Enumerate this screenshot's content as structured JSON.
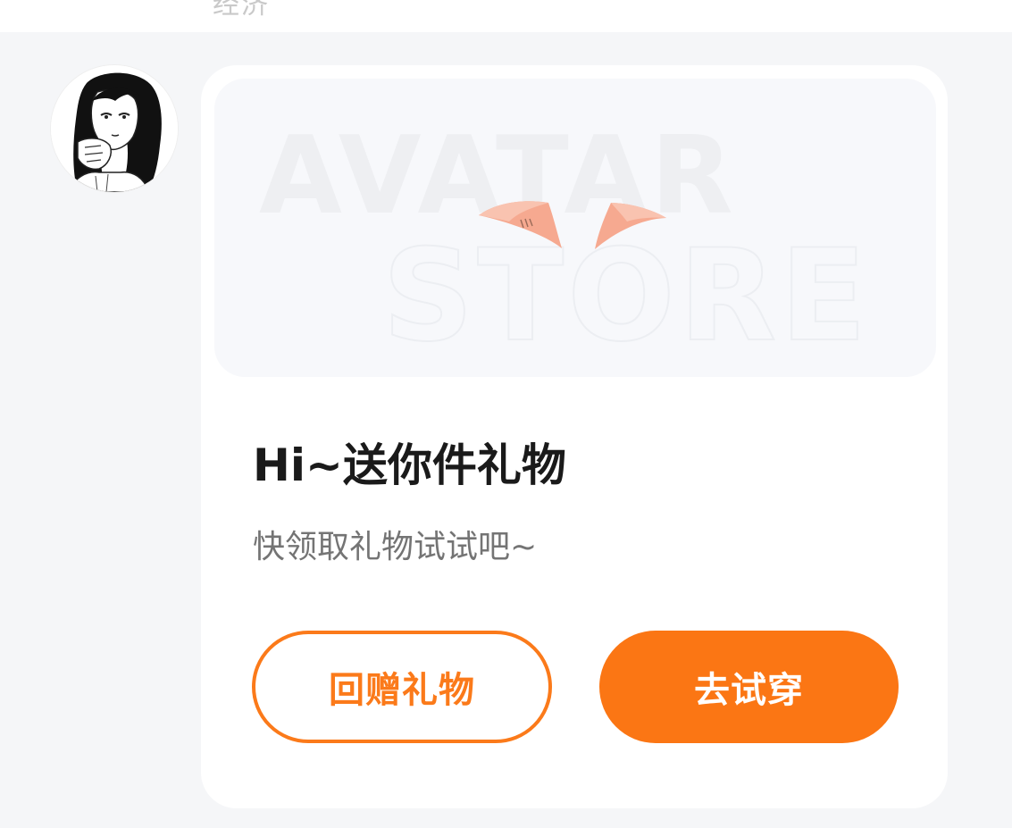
{
  "top_bar": {
    "partial_text": "经济"
  },
  "gift_card": {
    "banner": {
      "watermark_line1": "AVATAR",
      "watermark_line2": "STORE",
      "item_icon": "cat-ears-icon"
    },
    "title": "Hi~送你件礼物",
    "subtitle": "快领取礼物试试吧~",
    "return_gift_label": "回赠礼物",
    "try_on_label": "去试穿"
  },
  "colors": {
    "accent": "#fb7614",
    "page_bg": "#f5f6f8",
    "ears": "#f6a990"
  }
}
